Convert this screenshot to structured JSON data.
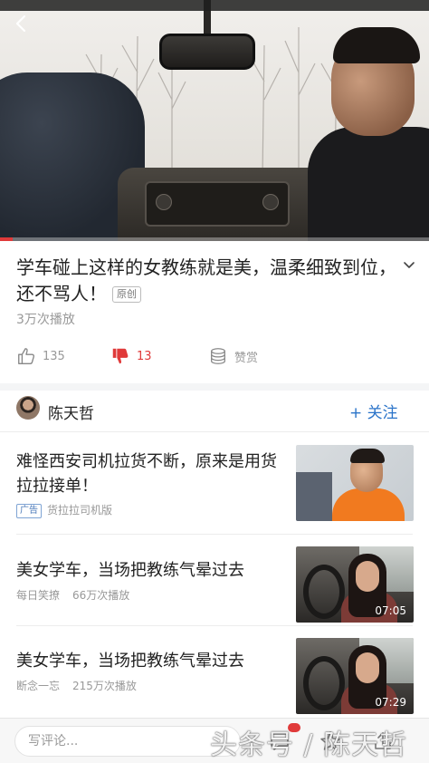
{
  "video": {
    "progress_fraction": 0.03
  },
  "article": {
    "title": "学车碰上这样的女教练就是美，温柔细致到位，还不骂人！",
    "original_badge": "原创",
    "plays": "3万次播放"
  },
  "actions": {
    "like_count": "135",
    "dislike_count": "13",
    "reward_label": "赞赏"
  },
  "author": {
    "name": "陈天哲",
    "follow_label": "+ 关注"
  },
  "feed": [
    {
      "title": "难怪西安司机拉货不断，原来是用货拉拉接单！",
      "ad_tag": "广告",
      "source": "货拉拉司机版",
      "plays": "",
      "duration": ""
    },
    {
      "title": "美女学车，当场把教练气晕过去",
      "ad_tag": "",
      "source": "每日笑撩",
      "plays": "66万次播放",
      "duration": "07:05"
    },
    {
      "title": "美女学车，当场把教练气晕过去",
      "ad_tag": "",
      "source": "断念一忘",
      "plays": "215万次播放",
      "duration": "07:29"
    }
  ],
  "comment_bar": {
    "placeholder": "写评论..."
  },
  "watermark": "头条号 / 陈天哲",
  "colors": {
    "accent_red": "#e03a3a",
    "follow_blue": "#2b74c9",
    "muted_text": "#999999"
  }
}
